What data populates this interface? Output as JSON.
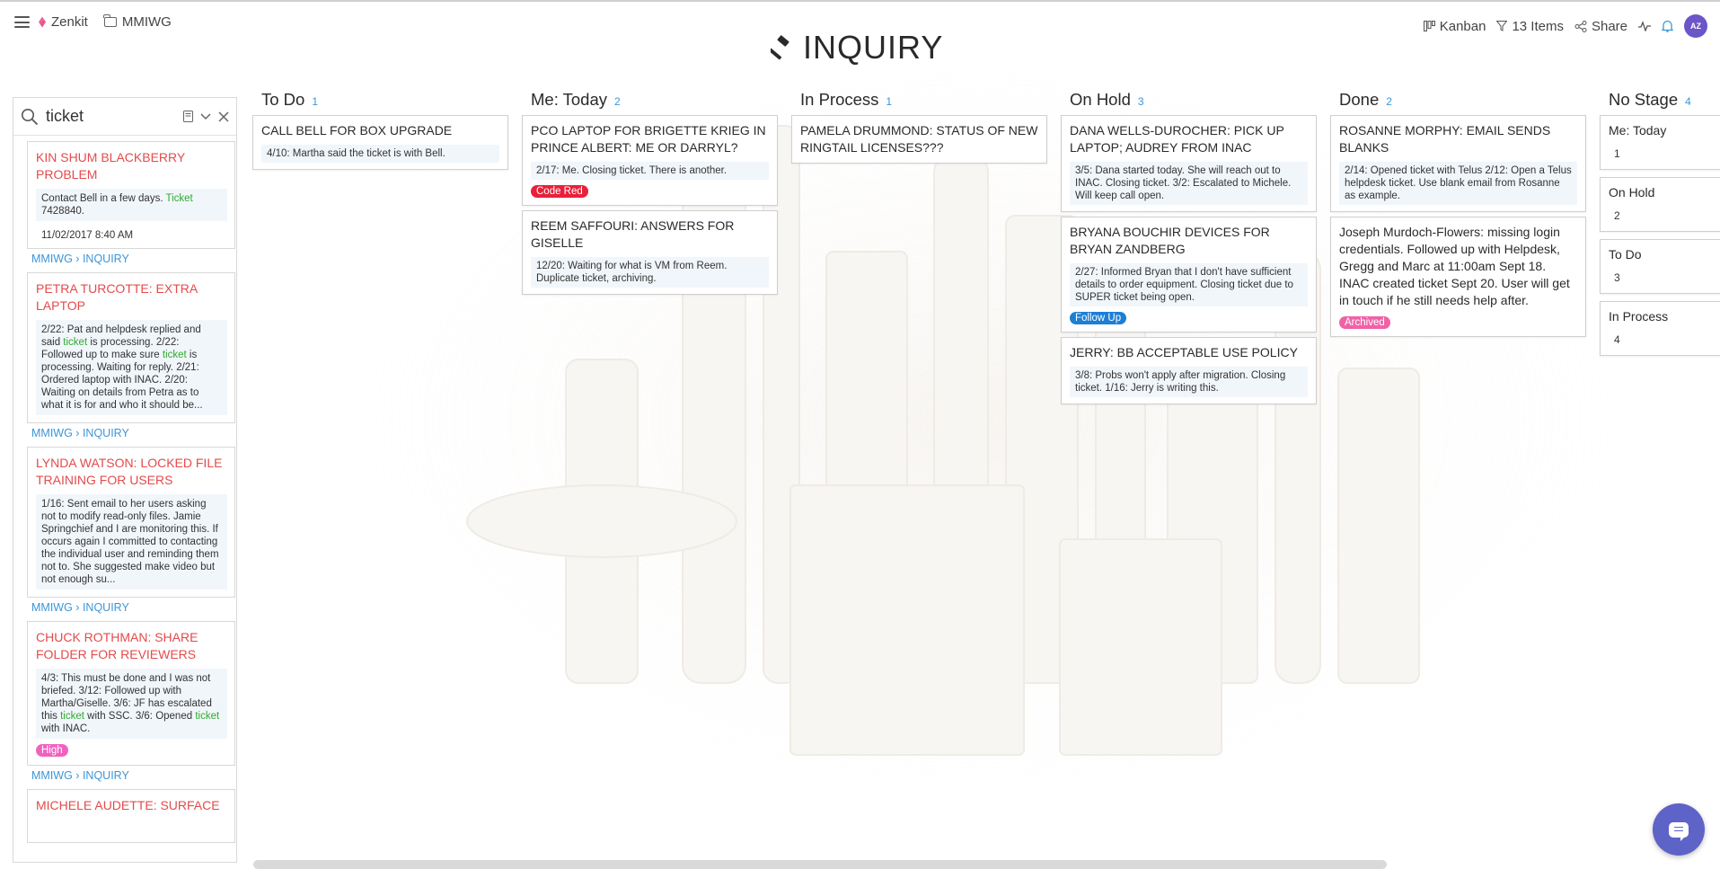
{
  "header": {
    "app_name": "Zenkit",
    "workspace": "MMIWG",
    "title": "INQUIRY",
    "view": "Kanban",
    "items_filter": "13 Items",
    "share": "Share",
    "avatar_initials": "AZ"
  },
  "search": {
    "query": "ticket",
    "results": [
      {
        "title": "KIN SHUM BLACKBERRY PROBLEM",
        "desc_parts": [
          "Contact Bell in a few days. ",
          "Ticket",
          " 7428840."
        ],
        "date": "11/02/2017 8:40 AM",
        "path_workspace": "MMIWG",
        "path_list": "INQUIRY"
      },
      {
        "title": "PETRA TURCOTTE: EXTRA LAPTOP",
        "desc_parts": [
          "2/22: Pat and helpdesk replied and said ",
          "ticket",
          " is processing. 2/22: Followed up to make sure ",
          "ticket",
          " is processing. Waiting for reply. 2/21: Ordered laptop with INAC. 2/20: Waiting on details from Petra as to what it is for and who it should be..."
        ],
        "path_workspace": "MMIWG",
        "path_list": "INQUIRY"
      },
      {
        "title": "LYNDA WATSON: LOCKED FILE TRAINING FOR USERS",
        "desc_parts": [
          "1/16: Sent email to her users asking not to modify read-only files. Jamie Springchief and I are monitoring this. If occurs again I committed to contacting the individual user and reminding them not to. She suggested make video but not enough su..."
        ],
        "path_workspace": "MMIWG",
        "path_list": "INQUIRY"
      },
      {
        "title": "CHUCK ROTHMAN: SHARE FOLDER FOR REVIEWERS",
        "desc_parts": [
          "4/3: This must be done and I was not briefed. 3/12: Followed up with Martha/Giselle. 3/6: JF has escalated this ",
          "ticket",
          " with SSC. 3/6: Opened ",
          "ticket",
          " with INAC."
        ],
        "tag": "High",
        "path_workspace": "MMIWG",
        "path_list": "INQUIRY"
      },
      {
        "title": "MICHELE AUDETTE: SURFACE"
      }
    ]
  },
  "columns": [
    {
      "name": "To Do",
      "count": "1",
      "cards": [
        {
          "title": "CALL BELL FOR BOX UPGRADE",
          "desc": "4/10: Martha said the ticket is with Bell."
        }
      ]
    },
    {
      "name": "Me: Today",
      "count": "2",
      "cards": [
        {
          "title": "PCO LAPTOP FOR BRIGETTE KRIEG IN PRINCE ALBERT: ME OR DARRYL?",
          "desc": "2/17: Me. Closing ticket. There is another.",
          "tag": "Code Red"
        },
        {
          "title": "REEM SAFFOURI: ANSWERS FOR GISELLE",
          "desc": "12/20: Waiting for what is VM from Reem. Duplicate ticket, archiving."
        }
      ]
    },
    {
      "name": "In Process",
      "count": "1",
      "cards": [
        {
          "title": "PAMELA DRUMMOND: STATUS OF NEW RINGTAIL LICENSES???"
        }
      ]
    },
    {
      "name": "On Hold",
      "count": "3",
      "cards": [
        {
          "title": "DANA WELLS-DUROCHER: PICK UP LAPTOP; AUDREY FROM INAC",
          "desc": "3/5: Dana started today. She will reach out to INAC. Closing ticket. 3/2: Escalated to Michele. Will keep call open."
        },
        {
          "title": "BRYANA BOUCHIR DEVICES FOR BRYAN ZANDBERG",
          "desc": "2/27: Informed Bryan that I don't have sufficient details to order equipment. Closing ticket due to SUPER ticket being open.",
          "tag": "Follow Up"
        },
        {
          "title": "JERRY: BB ACCEPTABLE USE POLICY",
          "desc": "3/8: Probs won't apply after migration. Closing ticket. 1/16: Jerry is writing this."
        }
      ]
    },
    {
      "name": "Done",
      "count": "2",
      "cards": [
        {
          "title": "ROSANNE MORPHY: EMAIL SENDS BLANKS",
          "desc": "2/14: Opened ticket with Telus 2/12: Open a Telus helpdesk ticket. Use blank email from Rosanne as example."
        },
        {
          "title": "Joseph Murdoch-Flowers: missing login credentials.  Followed up with Helpdesk, Gregg and Marc at 11:00am Sept 18. INAC created ticket Sept 20.  User will get in touch if he still needs help after.",
          "tag": "Archived"
        }
      ]
    },
    {
      "name": "No Stage",
      "count": "4",
      "cards": [
        {
          "title": "Me: Today",
          "desc": "1"
        },
        {
          "title": "On Hold",
          "desc": "2"
        },
        {
          "title": "To Do",
          "desc": "3"
        },
        {
          "title": "In Process",
          "desc": "4"
        }
      ]
    }
  ],
  "colors": {
    "accent": "#3b96d8",
    "result_title": "#e34b4b",
    "highlight": "#2faa2f",
    "tag_code_red": "#e8213a",
    "tag_follow_up": "#1b7fd6",
    "tag_archived": "#f062a8",
    "tag_high": "#f062c0",
    "chat": "#5e63c8"
  }
}
